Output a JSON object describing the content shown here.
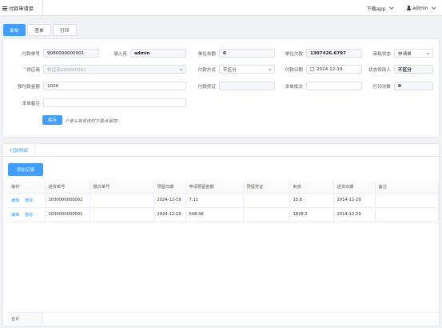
{
  "header": {
    "tab_title": "付款申请单",
    "download_label": "下载app",
    "user_label": "admin"
  },
  "toolbar": {
    "new_label": "新单",
    "review_label": "查单",
    "print_label": "打印"
  },
  "form": {
    "payment_no": {
      "label": "付款单号",
      "value": "9080000000001"
    },
    "entry_person": {
      "label": "录入员",
      "value": "admin"
    },
    "unit_balance": {
      "label": "单位余额",
      "value": "0"
    },
    "unit_due": {
      "label": "单位欠款",
      "value": "1307426.6797"
    },
    "review_status": {
      "label": "审批状态",
      "value": "申请单"
    },
    "supplier": {
      "label": "供应商",
      "placeholder": "供应商100000001"
    },
    "pay_method": {
      "label": "付款方式",
      "value": "不区分"
    },
    "pay_date": {
      "label": "付款日期",
      "value": "2024-12-19"
    },
    "status_modifier": {
      "label": "状态修改人",
      "value": "不区分"
    },
    "prepay_amount": {
      "label": "预付款金额",
      "value": "1000"
    },
    "pay_voucher": {
      "label": "付款凭证",
      "value": ""
    },
    "batch": {
      "label": "本单批次",
      "value": ""
    },
    "print_count": {
      "label": "打印次数",
      "value": "0"
    },
    "remark": {
      "label": "本单备注",
      "value": ""
    },
    "save_label": "保存",
    "save_note": "(*单头有更改时才需点保存)"
  },
  "details": {
    "tab_label": "付款明细",
    "add_label": "添加记录",
    "columns": [
      "操作",
      "进货单号",
      "报价单号",
      "预留日期",
      "申请预留金额",
      "预留凭证",
      "到货",
      "进货日期",
      "备注"
    ],
    "rows": [
      {
        "edit": "编辑",
        "delete": "删除",
        "purchase_no": "1030000000002",
        "quote_no": "",
        "reserve_date": "2024-12-19",
        "amount": "7.11",
        "voucher": "",
        "arrival": "15.8",
        "purchase_date": "2014-12-29",
        "note": ""
      },
      {
        "edit": "编辑",
        "delete": "删除",
        "purchase_no": "1030000000001",
        "quote_no": "",
        "reserve_date": "2024-12-19",
        "amount": "548.46",
        "voucher": "",
        "arrival": "1828.2",
        "purchase_date": "2014-12-29",
        "note": ""
      }
    ],
    "summary_label": "合计"
  },
  "colors": {
    "accent": "#409eff",
    "background": "#f0f2f5"
  }
}
